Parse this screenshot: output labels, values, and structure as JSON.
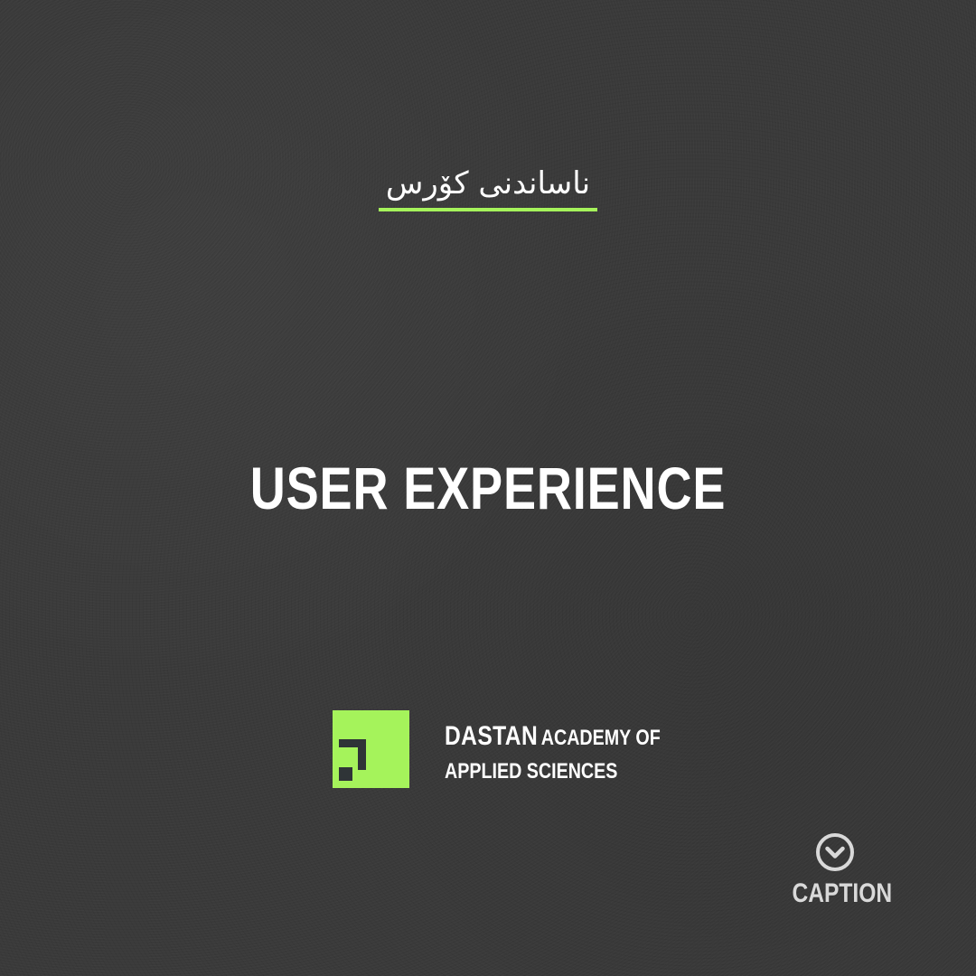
{
  "header": {
    "subtitle": "ناساندنی کۆرس",
    "accent_color": "#a5f35b"
  },
  "main": {
    "title": "USER EXPERIENCE"
  },
  "brand": {
    "logo_icon": "dastan-logo-icon",
    "name": "DASTAN",
    "name_rest": "ACADEMY OF",
    "line2": "APPLIED SCIENCES",
    "logo_color": "#a5f35b"
  },
  "caption": {
    "icon": "chevron-down-circle-icon",
    "label": "CAPTION"
  }
}
